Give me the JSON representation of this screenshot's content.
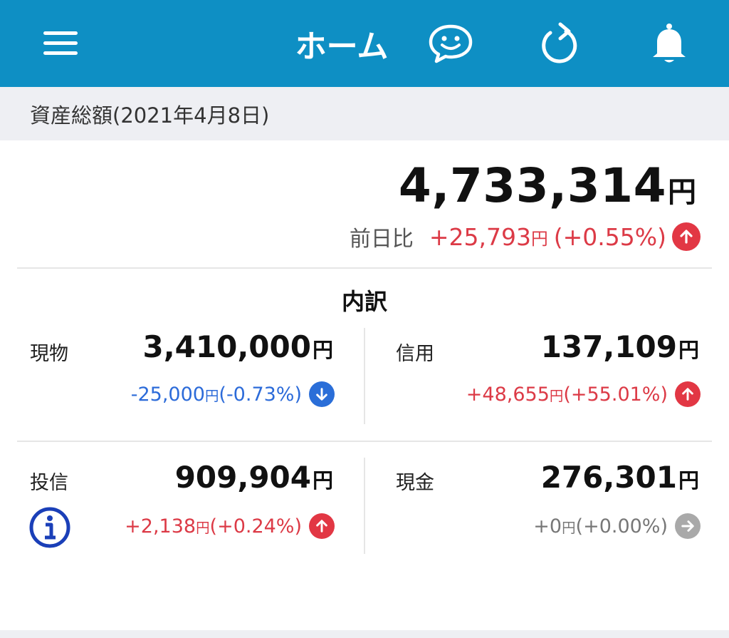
{
  "header": {
    "title": "ホーム",
    "icons": [
      "menu-icon",
      "chat-smile-icon",
      "refresh-icon",
      "bell-icon"
    ],
    "background_color": "#0e8fc4"
  },
  "summary": {
    "section_title": "資産総額(2021年4月8日)",
    "total_amount": "4,733,314",
    "yen": "円",
    "day_change_label": "前日比",
    "day_change_amount": "+25,793",
    "day_change_percent": "(+0.55%)",
    "direction": "up"
  },
  "breakdown": {
    "title": "内訳",
    "items": [
      {
        "label": "現物",
        "amount": "3,410,000",
        "change_amount": "-25,000",
        "change_percent": "(-0.73%)",
        "direction": "down"
      },
      {
        "label": "信用",
        "amount": "137,109",
        "change_amount": "+48,655",
        "change_percent": "(+55.01%)",
        "direction": "up"
      },
      {
        "label": "投信",
        "amount": "909,904",
        "change_amount": "+2,138",
        "change_percent": "(+0.24%)",
        "direction": "up"
      },
      {
        "label": "現金",
        "amount": "276,301",
        "change_amount": "+0",
        "change_percent": "(+0.00%)",
        "direction": "flat"
      }
    ]
  },
  "colors": {
    "positive": "#dc3a46",
    "negative": "#2c6bd9",
    "neutral": "#777777"
  }
}
